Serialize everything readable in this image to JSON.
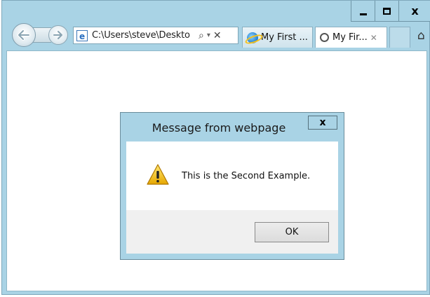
{
  "window": {
    "caption_buttons": {
      "minimize_icon": "minimize-icon",
      "maximize_icon": "maximize-icon",
      "close_glyph": "x"
    }
  },
  "navigation": {
    "back_icon": "back-arrow-icon",
    "forward_icon": "forward-arrow-icon",
    "address": "C:\\Users\\steve\\Deskto",
    "search_glyph": "⌕",
    "dropdown_glyph": "▾",
    "stop_glyph": "✕"
  },
  "tabs": [
    {
      "label": "My First ...",
      "icon": "ie-icon",
      "active": false
    },
    {
      "label": "My Fir...",
      "icon": "loading-icon",
      "active": true,
      "close_glyph": "✕"
    }
  ],
  "home_glyph": "⌂",
  "dialog": {
    "title": "Message from webpage",
    "close_glyph": "x",
    "message": "This is the Second Example.",
    "icon": "warning-icon",
    "ok_label": "OK"
  },
  "colors": {
    "frame": "#a9d3e5",
    "client": "#ffffff",
    "dialog_footer": "#f0f0f0"
  }
}
